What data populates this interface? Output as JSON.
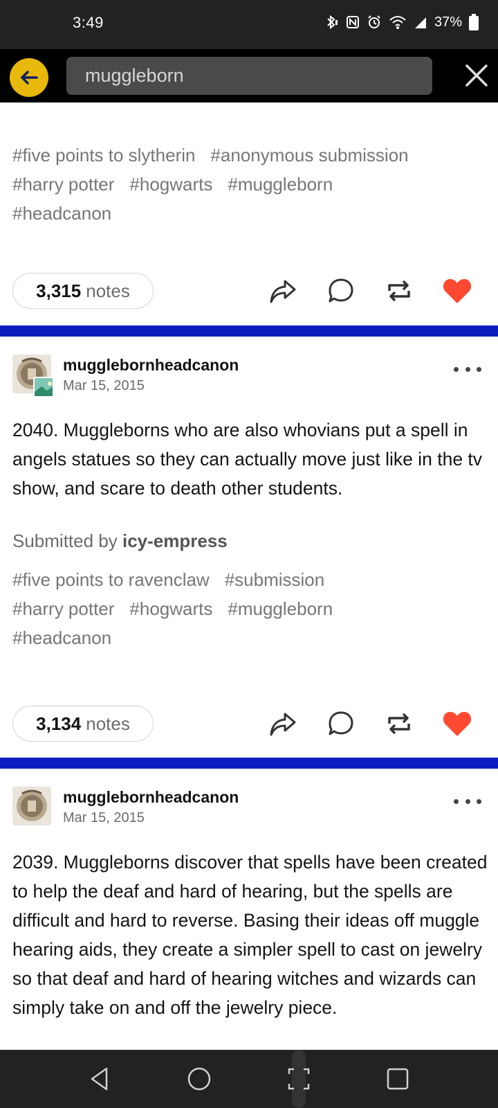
{
  "status_bar": {
    "time": "3:49",
    "battery": "37%"
  },
  "search": {
    "query": "muggleborn"
  },
  "posts": [
    {
      "tags": [
        "#five points to slytherin",
        "#anonymous submission",
        "#harry potter",
        "#hogwarts",
        "#muggleborn",
        "#headcanon"
      ],
      "notes_count": "3,315",
      "notes_label": "notes"
    },
    {
      "blog_name": "mugglebornheadcanon",
      "date": "Mar 15, 2015",
      "body": "2040. Muggleborns who are also whovians put a spell in angels statues so they can actually move just like in the tv show, and scare to death other students.",
      "submitted_prefix": "Submitted by",
      "submitted_by": "icy-empress",
      "tags": [
        "#five points to ravenclaw",
        "#submission",
        "#harry potter",
        "#hogwarts",
        "#muggleborn",
        "#headcanon"
      ],
      "notes_count": "3,134",
      "notes_label": "notes"
    },
    {
      "blog_name": "mugglebornheadcanon",
      "date": "Mar 15, 2015",
      "body": "2039. Muggleborns discover that spells have been created to help the deaf and hard of hearing, but the spells are difficult and hard to reverse. Basing their ideas off muggle hearing aids, they create a simpler spell to cast on jewelry so that deaf and hard of hearing witches and wizards can simply take on and off the jewelry piece."
    }
  ],
  "colors": {
    "accent_yellow": "#e8b80a",
    "divider_blue": "#0b1fc0",
    "like_red": "#ff4930"
  },
  "icons": {
    "back": "arrow-left-icon",
    "close": "close-icon",
    "share": "share-icon",
    "reply": "reply-icon",
    "reblog": "reblog-icon",
    "like": "heart-icon"
  }
}
